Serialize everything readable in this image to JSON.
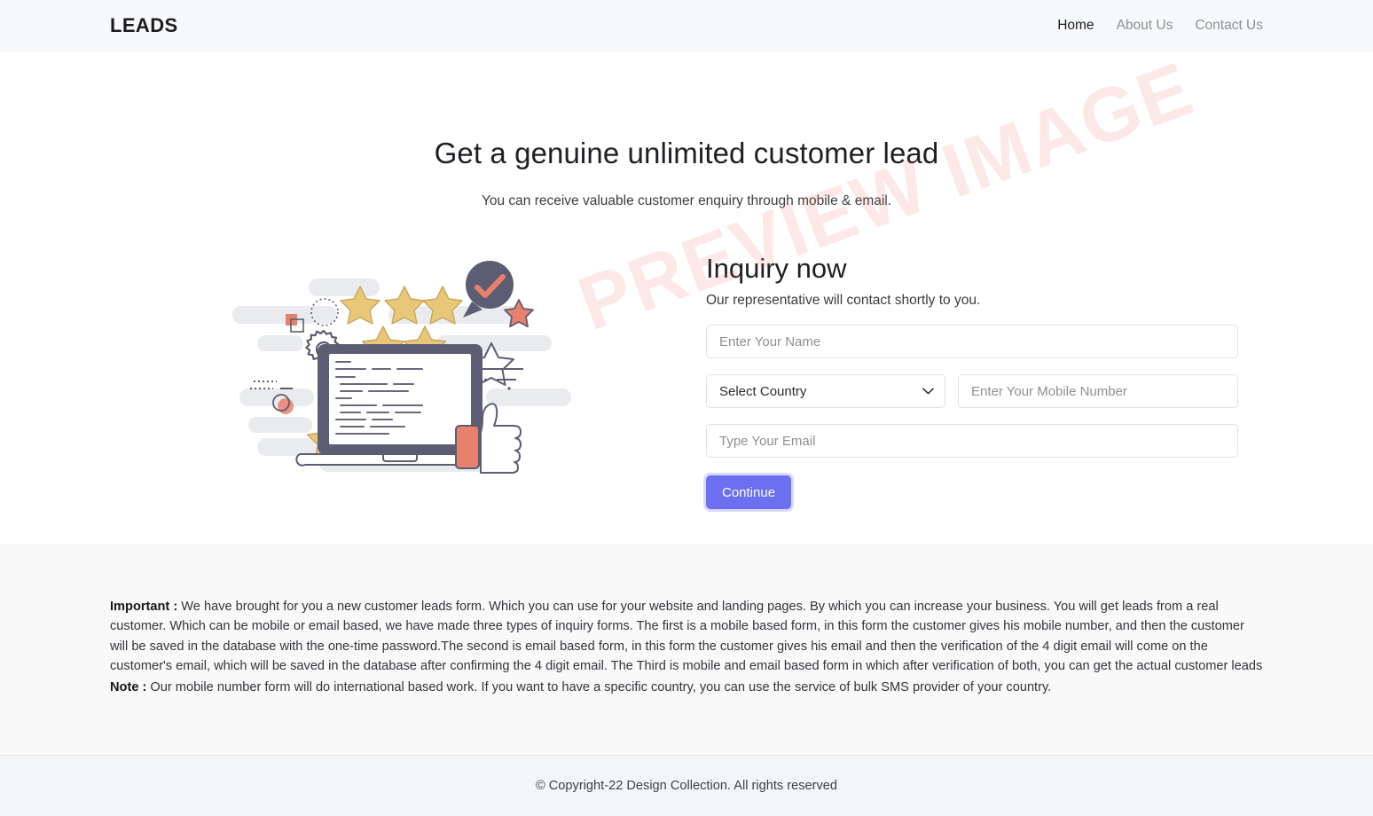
{
  "header": {
    "brand": "LEADS",
    "nav": [
      {
        "label": "Home",
        "active": true
      },
      {
        "label": "About Us",
        "active": false
      },
      {
        "label": "Contact Us",
        "active": false
      }
    ]
  },
  "hero": {
    "title": "Get a genuine unlimited customer lead",
    "subtitle": "You can receive valuable customer enquiry through mobile & email."
  },
  "form": {
    "title": "Inquiry now",
    "subtitle": "Our representative will contact shortly to you.",
    "name_placeholder": "Enter Your Name",
    "country_selected": "Select Country",
    "country_options": [
      "Select Country"
    ],
    "mobile_placeholder": "Enter Your Mobile Number",
    "email_placeholder": "Type Your Email",
    "submit_label": "Continue",
    "name_value": "",
    "mobile_value": "",
    "email_value": ""
  },
  "watermark": {
    "text": "PREVIEW IMAGE",
    "color": "#ec6e67"
  },
  "info": {
    "important_label": "Important :",
    "important_text": " We have brought for you a new customer leads form. Which you can use for your website and landing pages. By which you can increase your business. You will get leads from a real customer. Which can be mobile or email based, we have made three types of inquiry forms. The first is a mobile based form, in this form the customer gives his mobile number, and then the customer will be saved in the database with the one-time password.The second is email based form, in this form the customer gives his email and then the verification of the 4 digit email will come on the customer's email, which will be saved in the database after confirming the 4 digit email. The Third is mobile and email based form in which after verification of both, you can get the actual customer leads",
    "note_label": "Note :",
    "note_text": " Our mobile number form will do international based work. If you want to have a specific country, you can use the service of bulk SMS provider of your country."
  },
  "footer": {
    "copyright": "© Copyright-22 Design Collection. All rights reserved"
  },
  "theme": {
    "accent": "#6c6ff0",
    "header_bg": "#f8f9fa",
    "band_bg": "#f9f9fa",
    "footer_bg": "#f4f5f7",
    "illustration_dark": "#5c5d72",
    "illustration_star": "#e8c878",
    "illustration_orange": "#e8806e",
    "illustration_gray": "#e8eaee"
  },
  "illustration": {
    "name": "customer-review-laptop-illustration",
    "stars": 5
  }
}
